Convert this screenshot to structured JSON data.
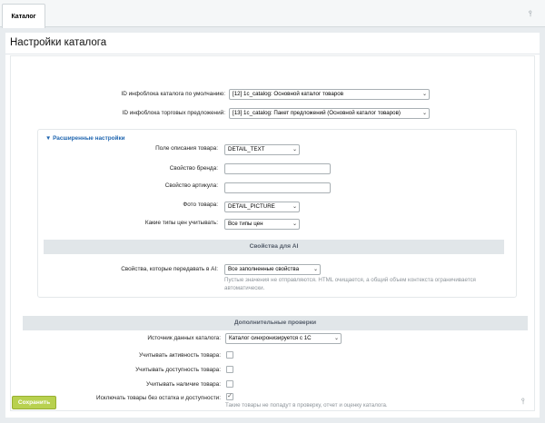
{
  "tab": {
    "label": "Каталог"
  },
  "page": {
    "title": "Настройки каталога"
  },
  "main": {
    "iblock_label": "ID инфоблока каталога по умолчанию:",
    "iblock_value": "[12] 1c_catalog: Основной каталог товаров",
    "offers_label": "ID инфоблока торговых предложений:",
    "offers_value": "[13] 1c_catalog: Пакет предложений (Основной каталог товаров)"
  },
  "advanced": {
    "header": "Расширенные настройки",
    "description_label": "Поле описания товара:",
    "description_value": "DETAIL_TEXT",
    "brand_label": "Свойство бренда:",
    "brand_value": "",
    "article_label": "Свойство артикула:",
    "article_value": "",
    "photo_label": "Фото товара:",
    "photo_value": "DETAIL_PICTURE",
    "price_label": "Какие типы цен учитывать:",
    "price_value": "Все типы цен",
    "ai_section_title": "Свойства для AI",
    "ai_props_label": "Свойства, которые передавать в AI:",
    "ai_props_value": "Все заполненные свойства",
    "ai_hint": "Пустые значения не отправляются. HTML очищается, а общий объем контекста ограничивается автоматически."
  },
  "checks": {
    "section_title": "Дополнительные проверки",
    "source_label": "Источник данных каталога:",
    "source_value": "Каталог синхронизируется с 1С",
    "activity_label": "Учитывать активность товара:",
    "activity_checked": false,
    "availability_label": "Учитывать доступность товара:",
    "availability_checked": false,
    "presence_label": "Учитывать наличие товара:",
    "presence_checked": false,
    "exclude_label": "Исключать товары без остатка и доступности:",
    "exclude_checked": true,
    "exclude_hint": "Такие товары не попадут в проверку, отчет и оценку каталога."
  },
  "footer": {
    "save_label": "Сохранить"
  },
  "icons": {
    "pin": "pin-icon",
    "triangle": "triangle-down-icon",
    "chevron": "chevron-down-icon",
    "check": "checkmark-icon"
  },
  "colors": {
    "accent": "#b8d14f",
    "link": "#2066b0",
    "section_bg": "#e1e6e9",
    "page_bg": "#e8ecef"
  }
}
